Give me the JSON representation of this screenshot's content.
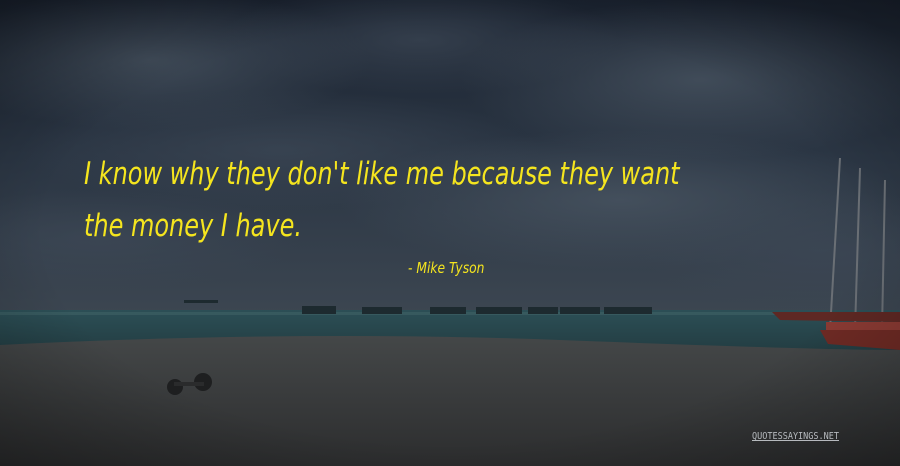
{
  "quote": {
    "line1": "I know why they don't like me because they want",
    "line2": "the money I have."
  },
  "author": "- Mike Tyson",
  "watermark": "QUOTESSAYINGS.NET",
  "colors": {
    "quote_text": "#f5e51e",
    "sky_top": "#1c2433",
    "sky_mid": "#2d3a48",
    "sea": "#24494f",
    "sand": "#3a3c3d",
    "boat_hull": "#6e2a24"
  }
}
